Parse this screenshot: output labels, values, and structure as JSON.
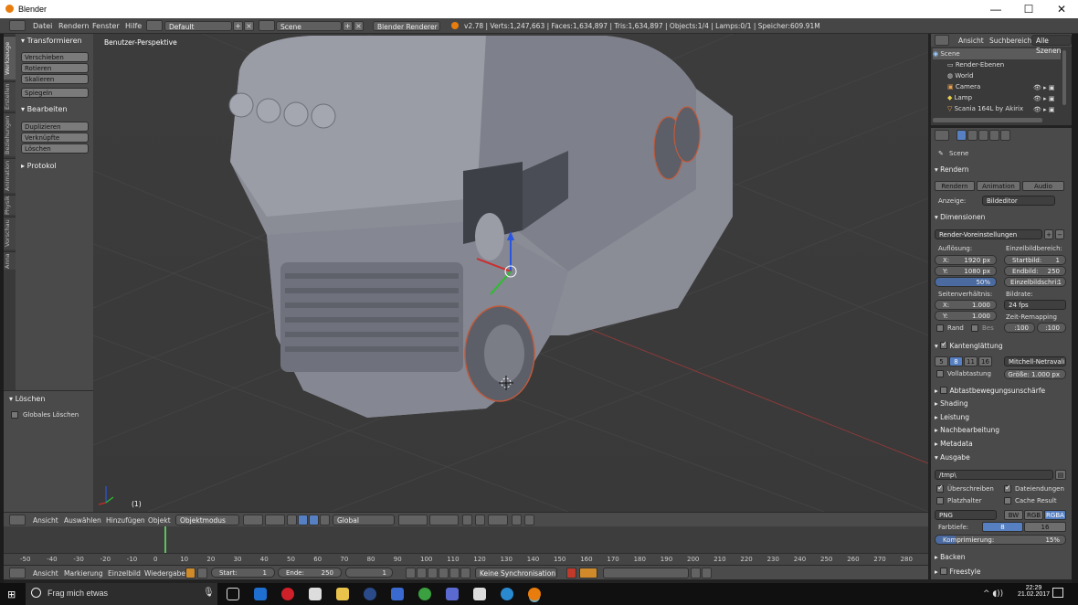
{
  "window": {
    "title": "Blender",
    "minimize": "—",
    "maximize": "☐",
    "close": "✕"
  },
  "menubar": {
    "items": [
      "Datei",
      "Rendern",
      "Fenster",
      "Hilfe"
    ],
    "layout": "Default",
    "scene": "Scene",
    "engine": "Blender Renderer",
    "stats": "v2.78 | Verts:1,247,663 | Faces:1,634,897 | Tris:1,634,897 | Objects:1/4 | Lamps:0/1 | Speicher:609.91M"
  },
  "toolshelf": {
    "tabs": [
      "Werkzeuge",
      "Erstellen",
      "Beziehungen",
      "Animation",
      "Physik",
      "Vorschau",
      "Anna"
    ],
    "transform_header": "Transformieren",
    "transform_buttons": [
      "Verschieben",
      "Rotieren",
      "Skalieren"
    ],
    "mirror_button": "Spiegeln",
    "edit_header": "Bearbeiten",
    "edit_buttons": [
      "Duplizieren",
      "Verknüpfte duplizieren",
      "Löschen"
    ],
    "history_header": "Protokol",
    "delete_header": "Löschen",
    "global_delete": "Globales Löschen"
  },
  "viewport": {
    "label": "Benutzer-Perspektive",
    "frame": "(1)"
  },
  "view3d_header": {
    "menus": [
      "Ansicht",
      "Auswählen",
      "Hinzufügen",
      "Objekt"
    ],
    "mode": "Objektmodus",
    "orientation": "Global"
  },
  "timeline": {
    "ticks": [
      "-50",
      "-40",
      "-30",
      "-20",
      "-10",
      "0",
      "10",
      "20",
      "30",
      "40",
      "50",
      "60",
      "70",
      "80",
      "90",
      "100",
      "110",
      "120",
      "130",
      "140",
      "150",
      "160",
      "170",
      "180",
      "190",
      "200",
      "210",
      "220",
      "230",
      "240",
      "250",
      "260",
      "270",
      "280"
    ],
    "menus": [
      "Ansicht",
      "Markierung",
      "Einzelbild",
      "Wiedergabe"
    ],
    "start_label": "Start:",
    "start": "1",
    "end_label": "Ende:",
    "end": "250",
    "current": "1",
    "sync": "Keine Synchronisation"
  },
  "outliner": {
    "menus": [
      "Ansicht",
      "Suchbereich"
    ],
    "filter": "Alle Szenen",
    "rows": [
      "Scene",
      "Render-Ebenen",
      "World",
      "Camera",
      "Lamp",
      "Scania 164L by Akirix"
    ]
  },
  "properties": {
    "context": "Scene",
    "render": {
      "header": "Rendern",
      "buttons": [
        "Rendern",
        "Animation",
        "Audio"
      ],
      "display_label": "Anzeige:",
      "display": "Bildeditor"
    },
    "dimensions": {
      "header": "Dimensionen",
      "preset": "Render-Voreinstellungen",
      "resolution_label": "Auflösung:",
      "res_x": "X:",
      "res_x_val": "1920 px",
      "res_y": "Y:",
      "res_y_val": "1080 px",
      "percent": "50%",
      "frame_range_label": "Einzelbildbereich:",
      "start": "Startbild:",
      "start_val": "1",
      "end": "Endbild:",
      "end_val": "250",
      "step": "Einzelbildschri:",
      "step_val": "1",
      "aspect_label": "Seitenverhältnis:",
      "asp_x": "X:",
      "asp_x_val": "1.000",
      "asp_y": "Y:",
      "asp_y_val": "1.000",
      "fps_label": "Bildrate:",
      "fps": "24 fps",
      "remap_label": "Zeit-Remapping",
      "remap_old": ":100",
      "remap_new": ":100",
      "border": "Rand",
      "crop": "Bes"
    },
    "antialias": {
      "header": "Kantenglättung",
      "samples": [
        "5",
        "8",
        "11",
        "16"
      ],
      "filter": "Mitchell-Netravali",
      "full_sample": "Vollabtastung",
      "size": "Größe: 1.000 px"
    },
    "collapsed": [
      "Abtastbewegungsunschärfe",
      "Shading",
      "Leistung",
      "Nachbearbeitung",
      "Metadata"
    ],
    "output": {
      "header": "Ausgabe",
      "path": "/tmp\\",
      "overwrite": "Überschreiben",
      "extensions": "Dateiendungen",
      "placeholders": "Platzhalter",
      "cache": "Cache Result",
      "format": "PNG",
      "modes": [
        "BW",
        "RGB",
        "RGBA"
      ],
      "depth_label": "Farbtiefe:",
      "depths": [
        "8",
        "16"
      ],
      "compression": "Komprimierung:",
      "compression_val": "15%"
    },
    "tail": [
      "Backen",
      "Freestyle"
    ]
  },
  "taskbar": {
    "search": "Frag mich etwas",
    "time": "22:29",
    "date": "21.02.2017"
  }
}
